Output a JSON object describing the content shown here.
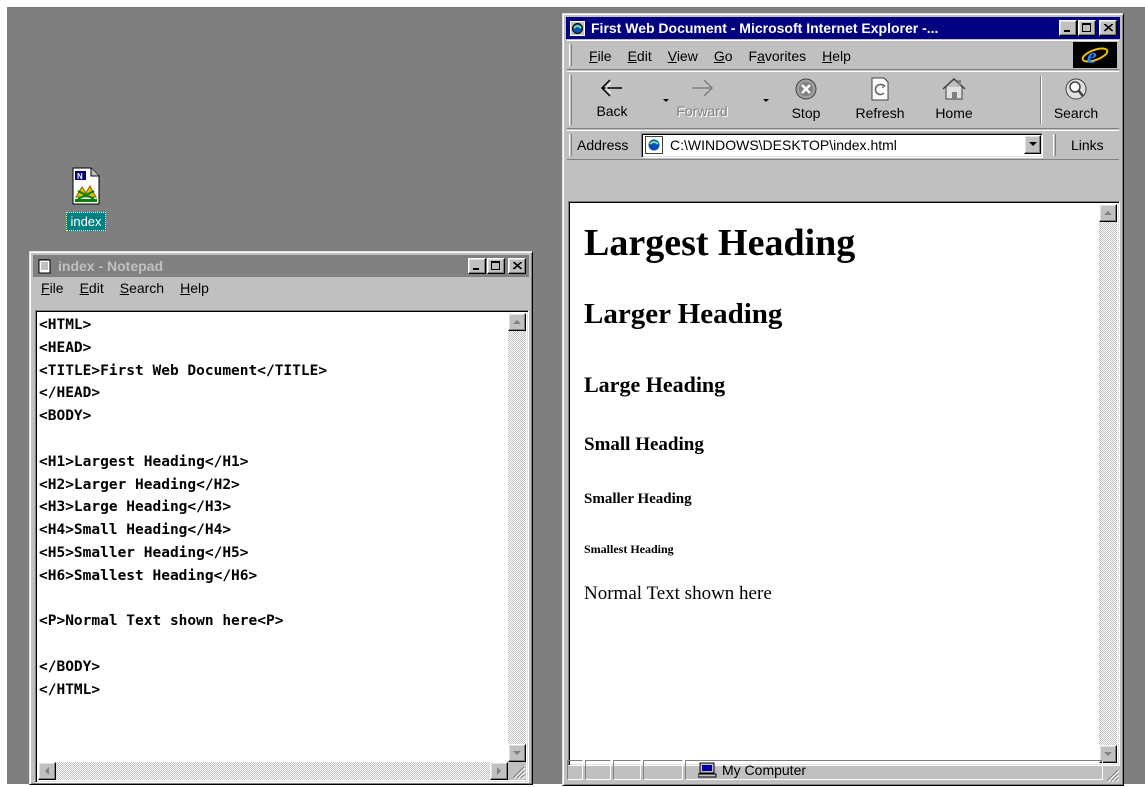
{
  "desktop": {
    "icon_label": "index"
  },
  "notepad": {
    "title": "index - Notepad",
    "menu": [
      {
        "label": "File",
        "accel": "F",
        "rest": "ile"
      },
      {
        "label": "Edit",
        "accel": "E",
        "rest": "dit"
      },
      {
        "label": "Search",
        "accel": "S",
        "rest": "earch"
      },
      {
        "label": "Help",
        "accel": "H",
        "rest": "elp"
      }
    ],
    "content_lines": [
      "<HTML>",
      "<HEAD>",
      "<TITLE>First Web Document</TITLE>",
      "</HEAD>",
      "<BODY>",
      "",
      "<H1>Largest Heading</H1>",
      "<H2>Larger Heading</H2>",
      "<H3>Large Heading</H3>",
      "<H4>Small Heading</H4>",
      "<H5>Smaller Heading</H5>",
      "<H6>Smallest Heading</H6>",
      "",
      "<P>Normal Text shown here<P>",
      "",
      "</BODY>",
      "</HTML>"
    ]
  },
  "ie": {
    "title": "First Web Document - Microsoft Internet Explorer -...",
    "menu": [
      {
        "label": "File",
        "accel": "F",
        "rest": "ile"
      },
      {
        "label": "Edit",
        "accel": "E",
        "rest": "dit"
      },
      {
        "label": "View",
        "accel": "V",
        "rest": "iew"
      },
      {
        "label": "Go",
        "accel": "G",
        "rest": "o"
      },
      {
        "label": "Favorites",
        "accel": "a",
        "pre": "F",
        "rest": "vorites"
      },
      {
        "label": "Help",
        "accel": "H",
        "rest": "elp"
      }
    ],
    "toolbar": {
      "back": "Back",
      "forward": "Forward",
      "stop": "Stop",
      "refresh": "Refresh",
      "home": "Home",
      "search": "Search"
    },
    "address_label": "Address",
    "address_value": "C:\\WINDOWS\\DESKTOP\\index.html",
    "links_label": "Links",
    "page": {
      "h1": "Largest Heading",
      "h2": "Larger Heading",
      "h3": "Large Heading",
      "h4": "Small Heading",
      "h5": "Smaller Heading",
      "h6": "Smallest Heading",
      "p": "Normal Text shown here"
    },
    "status_zone": "My Computer"
  },
  "colors": {
    "desktop": "#7f7f7f",
    "active_title": "#000080",
    "inactive_title": "#808080",
    "face": "#c0c0c0",
    "icon_selection": "#008080"
  }
}
